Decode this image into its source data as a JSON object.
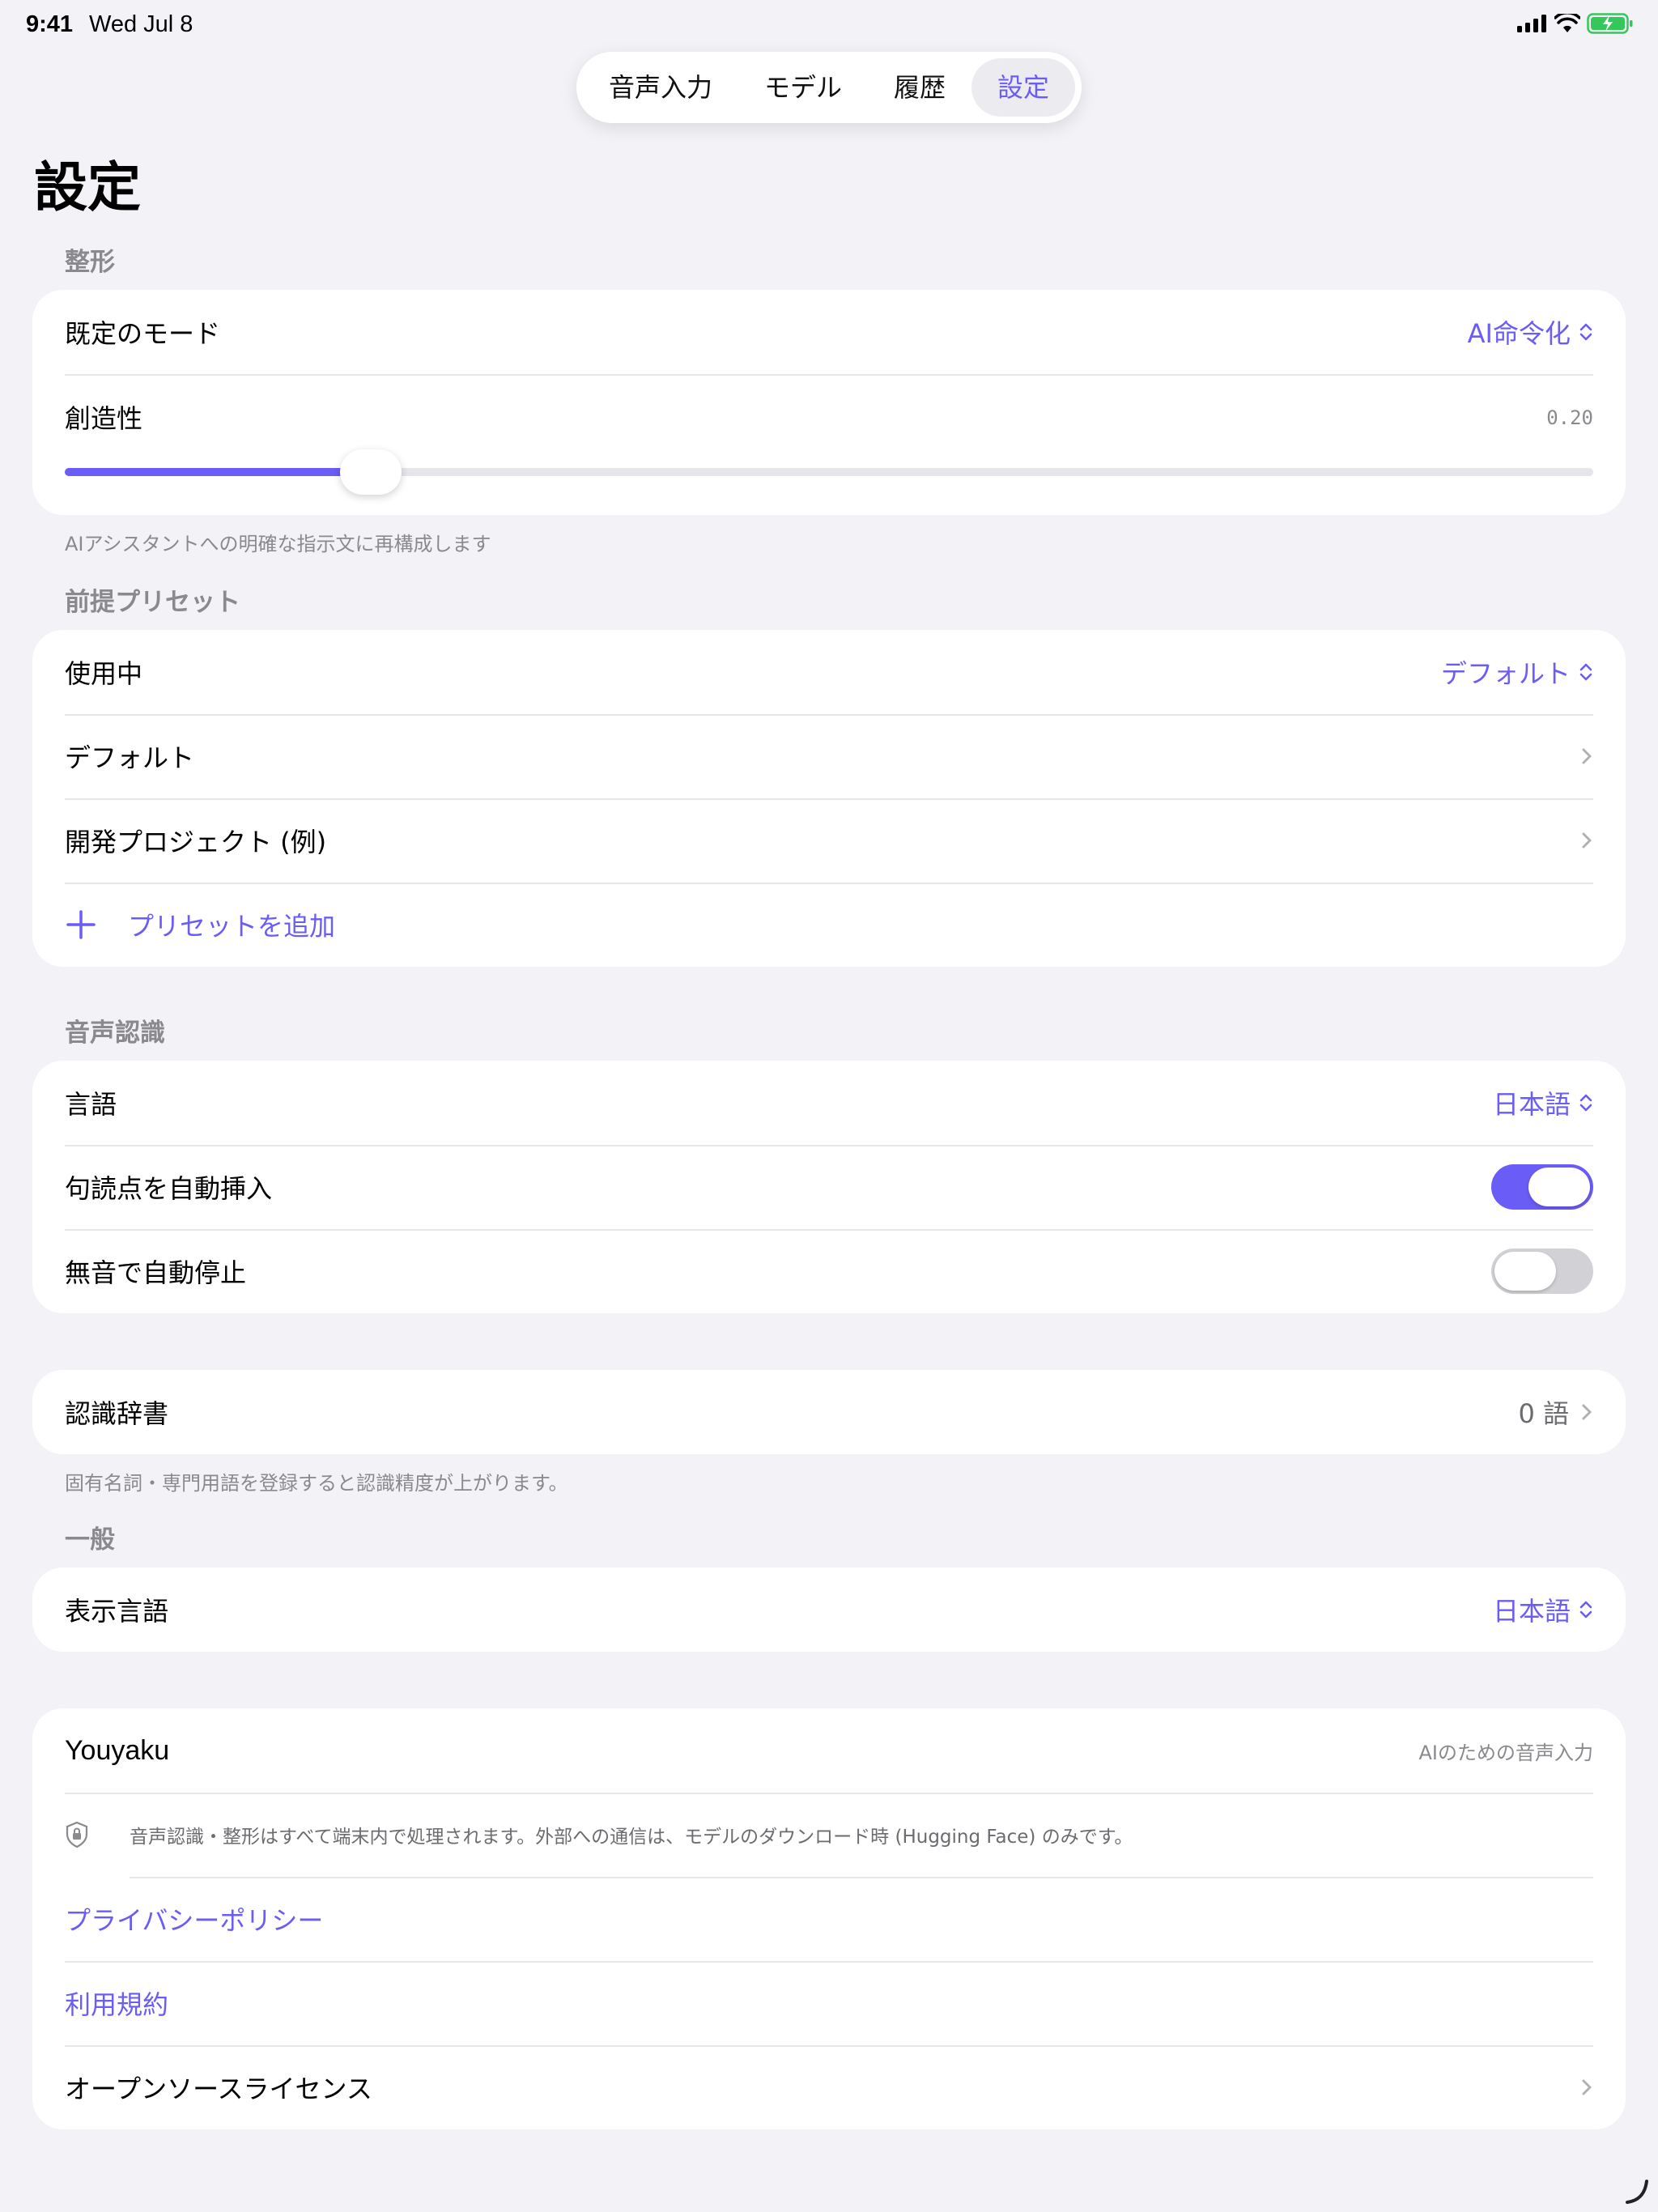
{
  "status": {
    "time": "9:41",
    "date": "Wed Jul 8"
  },
  "tabs": [
    {
      "label": "音声入力"
    },
    {
      "label": "モデル"
    },
    {
      "label": "履歴"
    },
    {
      "label": "設定",
      "active": true
    }
  ],
  "page_title": "設定",
  "formatting": {
    "header": "整形",
    "default_mode_label": "既定のモード",
    "default_mode_value": "AI命令化",
    "creativity_label": "創造性",
    "creativity_value": "0.20",
    "creativity_fraction": 0.2,
    "footer": "AIアシスタントへの明確な指示文に再構成します"
  },
  "presets": {
    "header": "前提プリセット",
    "in_use_label": "使用中",
    "in_use_value": "デフォルト",
    "items": [
      "デフォルト",
      "開発プロジェクト (例)"
    ],
    "add_label": "プリセットを追加"
  },
  "speech": {
    "header": "音声認識",
    "language_label": "言語",
    "language_value": "日本語",
    "punctuation_label": "句読点を自動挿入",
    "punctuation_on": true,
    "silence_label": "無音で自動停止",
    "silence_on": false
  },
  "dictionary": {
    "label": "認識辞書",
    "value": "0 語",
    "footer": "固有名詞・専門用語を登録すると認識精度が上がります。"
  },
  "general": {
    "header": "一般",
    "display_language_label": "表示言語",
    "display_language_value": "日本語"
  },
  "about": {
    "app_name": "Youyaku",
    "tagline": "AIのための音声入力",
    "privacy_note": "音声認識・整形はすべて端末内で処理されます。外部への通信は、モデルのダウンロード時 (Hugging Face) のみです。",
    "privacy_policy": "プライバシーポリシー",
    "terms": "利用規約",
    "oss_licenses": "オープンソースライセンス"
  },
  "colors": {
    "accent": "#6a5cf6",
    "background": "#f2f2f7",
    "battery": "#34c759"
  },
  "icons": [
    "signal-icon",
    "wifi-icon",
    "battery-icon",
    "chevron-updown-icon",
    "chevron-right-icon",
    "plus-icon",
    "shield-lock-icon",
    "resize-handle-icon"
  ]
}
